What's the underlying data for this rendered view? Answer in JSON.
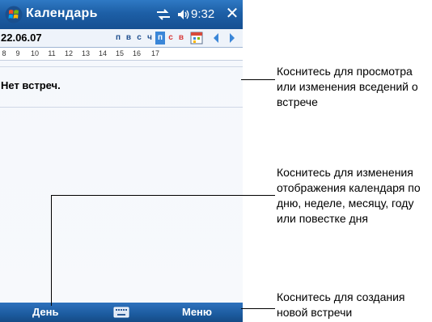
{
  "titlebar": {
    "app_title": "Календарь",
    "clock": "9:32",
    "close_symbol": "✕",
    "logo_icon": "windows-logo-icon",
    "connectivity_icon": "connectivity-icon",
    "volume_icon": "speaker-icon"
  },
  "date_bar": {
    "current_date": "22.06.07",
    "weekdays": [
      {
        "label": "п",
        "selected": false,
        "weekend": false
      },
      {
        "label": "в",
        "selected": false,
        "weekend": false
      },
      {
        "label": "с",
        "selected": false,
        "weekend": false
      },
      {
        "label": "ч",
        "selected": false,
        "weekend": false
      },
      {
        "label": "п",
        "selected": true,
        "weekend": false
      },
      {
        "label": "с",
        "selected": false,
        "weekend": true
      },
      {
        "label": "в",
        "selected": false,
        "weekend": true
      }
    ],
    "icons": [
      "today-calendar-icon",
      "arrow-left-icon",
      "arrow-right-icon"
    ]
  },
  "hours": [
    "8",
    "9",
    "10",
    "11",
    "12",
    "13",
    "14",
    "15",
    "16",
    "17"
  ],
  "agenda": {
    "empty_text": "Нет встреч."
  },
  "menubar": {
    "left_label": "День",
    "right_label": "Меню",
    "center_icon": "keyboard-icon"
  },
  "callouts": [
    {
      "text": "Коснитесь для просмотра или изменения вседений о встрече"
    },
    {
      "text": "Коснитесь для изменения отображения календаря по дню, неделе, месяцу, году или повестке дня"
    },
    {
      "text": "Коснитесь для создания новой встречи"
    }
  ],
  "colors": {
    "title_bar": "#1d5fa6",
    "selected_day": "#3a86d8",
    "weekend_day": "#d83a3a"
  }
}
